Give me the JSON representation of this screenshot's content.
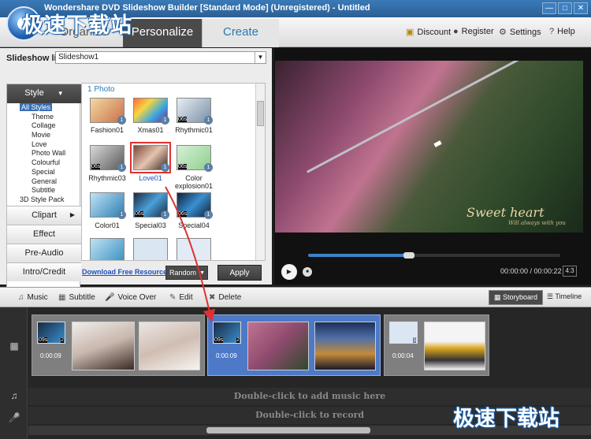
{
  "window": {
    "title": "Wondershare DVD Slideshow Builder [Standard Mode] (Unregistered) - Untitled",
    "controls": [
      "—",
      "□",
      "✕"
    ]
  },
  "watermark": "极速下载站",
  "tabs": [
    {
      "label": "Organize"
    },
    {
      "label": "Personalize"
    },
    {
      "label": "Create"
    }
  ],
  "top_links": [
    {
      "label": "Discount",
      "icon": "cart-icon"
    },
    {
      "label": "Register",
      "icon": "user-icon"
    },
    {
      "label": "Settings",
      "icon": "gear-icon"
    },
    {
      "label": "Help",
      "icon": "help-icon"
    }
  ],
  "slideshow_list": {
    "label": "Slideshow list :",
    "value": "Slideshow1"
  },
  "left_menu": {
    "style_header": "Style",
    "tree": [
      "All Styles",
      "Theme",
      "Collage",
      "Movie",
      "Love",
      "Photo Wall",
      "Colourful",
      "Special",
      "General",
      "Subtitle",
      "3D Style Pack"
    ],
    "sections": [
      "Clipart",
      "Effect",
      "Pre-Audio",
      "Intro/Credit"
    ]
  },
  "styles": {
    "photo_count": "1 Photo",
    "items": [
      {
        "label": "Fashion01",
        "badge": "1"
      },
      {
        "label": "Xmas01",
        "badge": "1"
      },
      {
        "label": "Rhythmic01",
        "badge": "1",
        "dur": "06s"
      },
      {
        "label": "Rhythmic03",
        "badge": "1",
        "dur": "06s"
      },
      {
        "label": "Love01",
        "badge": "1",
        "selected": true
      },
      {
        "label": "Color explosion01",
        "badge": "1",
        "dur": "06s"
      },
      {
        "label": "Color01",
        "badge": "1"
      },
      {
        "label": "Special03",
        "badge": "1",
        "dur": "06s"
      },
      {
        "label": "Special04",
        "badge": "1",
        "dur": "06s"
      }
    ],
    "download_link": "Download Free Resource",
    "random": "Random",
    "apply": "Apply"
  },
  "preview": {
    "caption": "Sweet heart",
    "caption_sub": "Will always with you",
    "time": "00:00:00 / 00:00:22",
    "ratio": "4:3",
    "progress": 0.4
  },
  "toolbar": {
    "music": "Music",
    "subtitle": "Subtitle",
    "voice_over": "Voice Over",
    "edit": "Edit",
    "delete": "Delete",
    "storyboard": "Storyboard",
    "timeline": "Timeline"
  },
  "storyboard": {
    "slides": [
      {
        "mini_dur": "09s",
        "mini_count": "2",
        "duration": "0:00:09"
      },
      {
        "mini_dur": "09s",
        "mini_count": "2",
        "duration": "0:00:09",
        "active": true
      },
      {
        "mini_count": "1",
        "duration": "0:00:04"
      }
    ],
    "music_hint": "Double-click to add music here",
    "record_hint": "Double-click to record"
  },
  "colors": {
    "accent": "#2a7ab0",
    "active_slide": "#4d79c7",
    "highlight": "#e03030"
  }
}
